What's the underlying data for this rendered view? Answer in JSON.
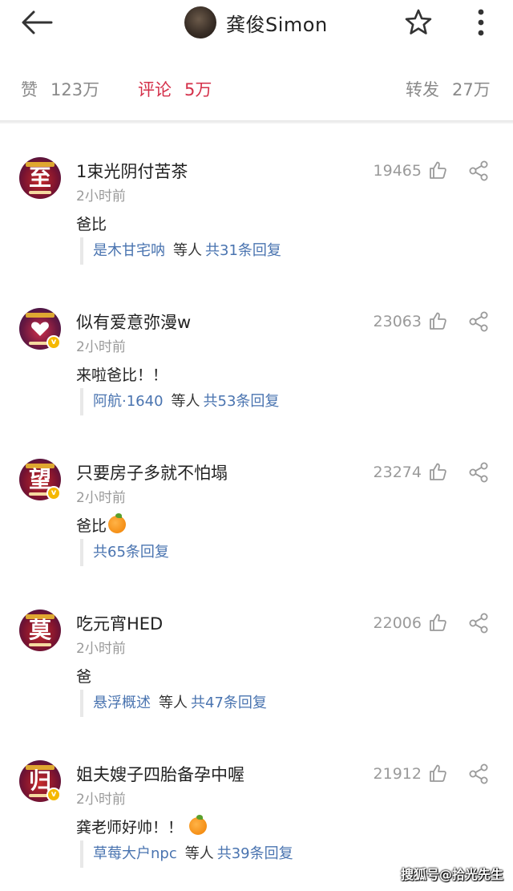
{
  "header": {
    "title": "龚俊Simon",
    "back_icon": "arrow-left-icon",
    "star_icon": "star-icon",
    "more_icon": "more-vertical-icon"
  },
  "stats": {
    "likes_label": "赞",
    "likes_value": "123万",
    "comments_label": "评论",
    "comments_value": "5万",
    "reposts_label": "转发",
    "reposts_value": "27万",
    "active_color": "#d4304a"
  },
  "comments": [
    {
      "glyph": "至",
      "name": "1束光阴付苦茶",
      "time": "2小时前",
      "text": "爸比",
      "likes": "19465",
      "reply_who": "是木甘宅呐",
      "reply_etc": "等人",
      "reply_total": "共31条回复"
    },
    {
      "glyph": "",
      "name": "似有爱意弥漫w",
      "time": "2小时前",
      "text": "来啦爸比！！",
      "likes": "23063",
      "reply_who": "阿航·1640",
      "reply_etc": "等人",
      "reply_total": "共53条回复"
    },
    {
      "glyph": "望",
      "name": "只要房子多就不怕塌",
      "time": "2小时前",
      "text": "爸比",
      "likes": "23274",
      "reply_who": "",
      "reply_etc": "",
      "reply_total": "共65条回复"
    },
    {
      "glyph": "莫",
      "name": "吃元宵HED",
      "time": "2小时前",
      "text": "爸",
      "likes": "22006",
      "reply_who": "悬浮概述",
      "reply_etc": "等人",
      "reply_total": "共47条回复"
    },
    {
      "glyph": "归",
      "name": "姐夫嫂子四胎备孕中喔",
      "time": "2小时前",
      "text": "龚老师好帅！！",
      "likes": "21912",
      "reply_who": "草莓大户npc",
      "reply_etc": "等人",
      "reply_total": "共39条回复"
    }
  ],
  "watermark": "搜狐号@拾光先生",
  "colors": {
    "link": "#4a74b0",
    "muted": "#9a9a9a",
    "verified": "#f5b800"
  }
}
